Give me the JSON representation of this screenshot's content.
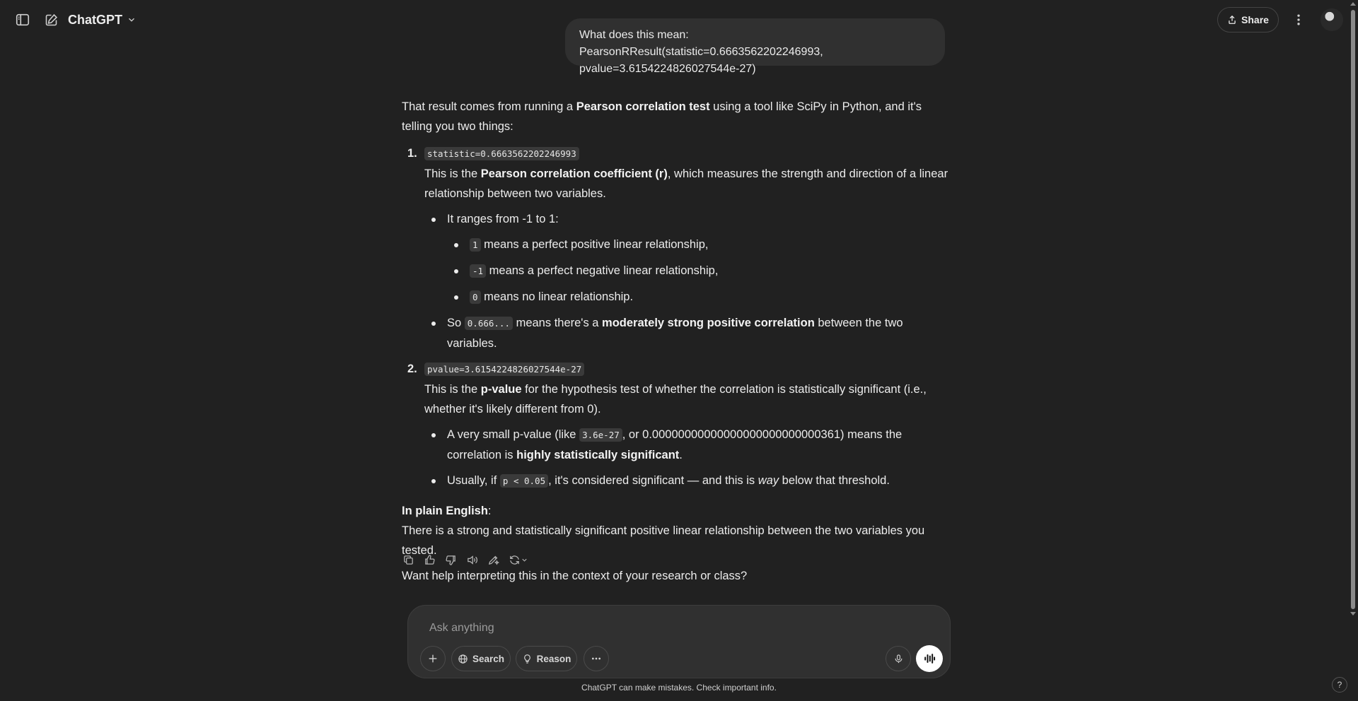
{
  "header": {
    "model_name": "ChatGPT",
    "share_label": "Share"
  },
  "icons": {
    "sidebar_toggle": "sidebar-toggle-icon",
    "new_chat": "edit-icon",
    "model_chevron": "chevron-down-icon",
    "share": "share-icon",
    "more": "more-vertical-icon"
  },
  "conversation": {
    "user_message": "What does this mean: PearsonRResult(statistic=0.6663562202246993, pvalue=3.6154224826027544e-27)",
    "answer": {
      "intro_pre": "That result comes from running a ",
      "intro_bold": "Pearson correlation test",
      "intro_post": " using a tool like SciPy in Python, and it's telling you two things:",
      "item1": {
        "marker": "1.",
        "code": "statistic=0.6663562202246993",
        "desc_pre": "This is the ",
        "desc_bold": "Pearson correlation coefficient (r)",
        "desc_post": ", which measures the strength and direction of a linear relationship between two variables.",
        "range_text": "It ranges from -1 to 1:",
        "sub1_code": "1",
        "sub1_text": " means a perfect positive linear relationship,",
        "sub2_code": "-1",
        "sub2_text": " means a perfect negative linear relationship,",
        "sub3_code": "0",
        "sub3_text": " means no linear relationship.",
        "so_pre": "So ",
        "so_code": "0.666...",
        "so_mid": " means there's a ",
        "so_bold": "moderately strong positive correlation",
        "so_post": " between the two variables."
      },
      "item2": {
        "marker": "2.",
        "code": "pvalue=3.6154224826027544e-27",
        "desc_pre": "This is the ",
        "desc_bold": "p-value",
        "desc_post": " for the hypothesis test of whether the correlation is statistically significant (i.e., whether it's likely different from 0).",
        "b1_pre": "A very small p-value (like ",
        "b1_code": "3.6e-27",
        "b1_mid": ", or 0.00000000000000000000000000361) means the correlation is ",
        "b1_bold": "highly statistically significant",
        "b1_post": ".",
        "b2_pre": "Usually, if ",
        "b2_code": "p < 0.05",
        "b2_mid": ", it's considered significant — and this is ",
        "b2_em": "way",
        "b2_post": " below that threshold."
      },
      "plain_heading": "In plain English",
      "plain_colon": ":",
      "plain_text": "There is a strong and statistically significant positive linear relationship between the two variables you tested.",
      "closing": "Want help interpreting this in the context of your research or class?"
    },
    "action_icons": [
      "copy-icon",
      "thumbs-up-icon",
      "thumbs-down-icon",
      "read-aloud-icon",
      "edit-canvas-icon",
      "regenerate-icon"
    ]
  },
  "composer": {
    "placeholder": "Ask anything",
    "search_label": "Search",
    "reason_label": "Reason"
  },
  "footer": {
    "disclaimer": "ChatGPT can make mistakes. Check important info.",
    "help": "?"
  }
}
